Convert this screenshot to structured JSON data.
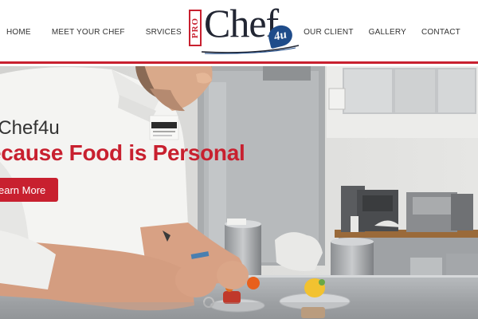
{
  "nav": {
    "left": [
      {
        "label": "HOME"
      },
      {
        "label": "MEET YOUR CHEF"
      },
      {
        "label": "SRVICES"
      }
    ],
    "right": [
      {
        "label": "OUR CLIENT"
      },
      {
        "label": "GALLERY"
      },
      {
        "label": "CONTACT"
      }
    ]
  },
  "logo": {
    "pro": "PRO",
    "chef": "Chef",
    "suffix": "4u"
  },
  "hero": {
    "subtitle": "oChef4u",
    "title": "ecause Food is Personal",
    "button_label": "earn More",
    "chef_badge": "DALTON"
  },
  "colors": {
    "accent": "#c8202f",
    "logo_dark": "#222633",
    "logo_blue": "#1f4c8a",
    "nav_text": "#333333"
  }
}
